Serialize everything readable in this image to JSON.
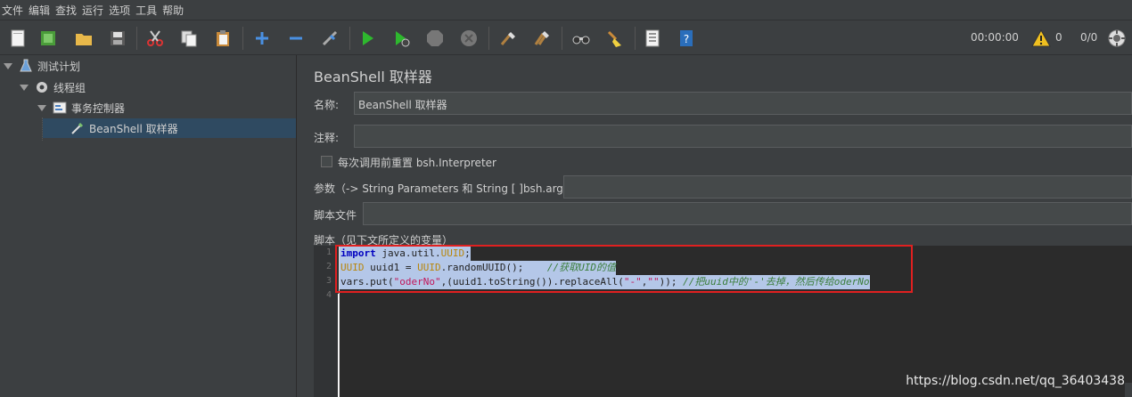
{
  "menu": [
    "文件",
    "编辑",
    "查找",
    "运行",
    "选项",
    "工具",
    "帮助"
  ],
  "toolbar": {
    "timer": "00:00:00",
    "warning_count": "0",
    "threads": "0/0"
  },
  "tree": [
    {
      "label": "测试计划"
    },
    {
      "label": "线程组"
    },
    {
      "label": "事务控制器"
    },
    {
      "label": "BeanShell 取样器"
    }
  ],
  "panel": {
    "title": "BeanShell 取样器",
    "name_label": "名称:",
    "name_value": "BeanShell 取样器",
    "comment_label": "注释:",
    "comment_value": "",
    "reset_label": "每次调用前重置 bsh.Interpreter",
    "params_label": "参数（-> String Parameters 和 String [ ]bsh.args）",
    "params_value": "",
    "file_label": "脚本文件",
    "file_value": "",
    "script_label": "脚本（见下文所定义的变量）"
  },
  "code": {
    "line_numbers": [
      "1",
      "2",
      "3",
      "4"
    ],
    "l1_kw": "import",
    "l1_pkg": " java.util.",
    "l1_cls": "UUID",
    "l1_end": ";",
    "l2_cls": "UUID",
    "l2_mid": " uuid1 = ",
    "l2_cls2": "UUID",
    "l2_call": ".randomUUID();    ",
    "l2_cm": "//获取UID的值",
    "l3_a": "vars.put(",
    "l3_s1": "\"oderNo\"",
    "l3_b": ",(uuid1.toString()).replaceAll(",
    "l3_s2": "\"-\"",
    "l3_c": ",",
    "l3_s3": "\"\"",
    "l3_d": ")); ",
    "l3_cm": "//把uuid中的'-'去掉，然后传给oderNo"
  },
  "watermark": "https://blog.csdn.net/qq_36403438"
}
